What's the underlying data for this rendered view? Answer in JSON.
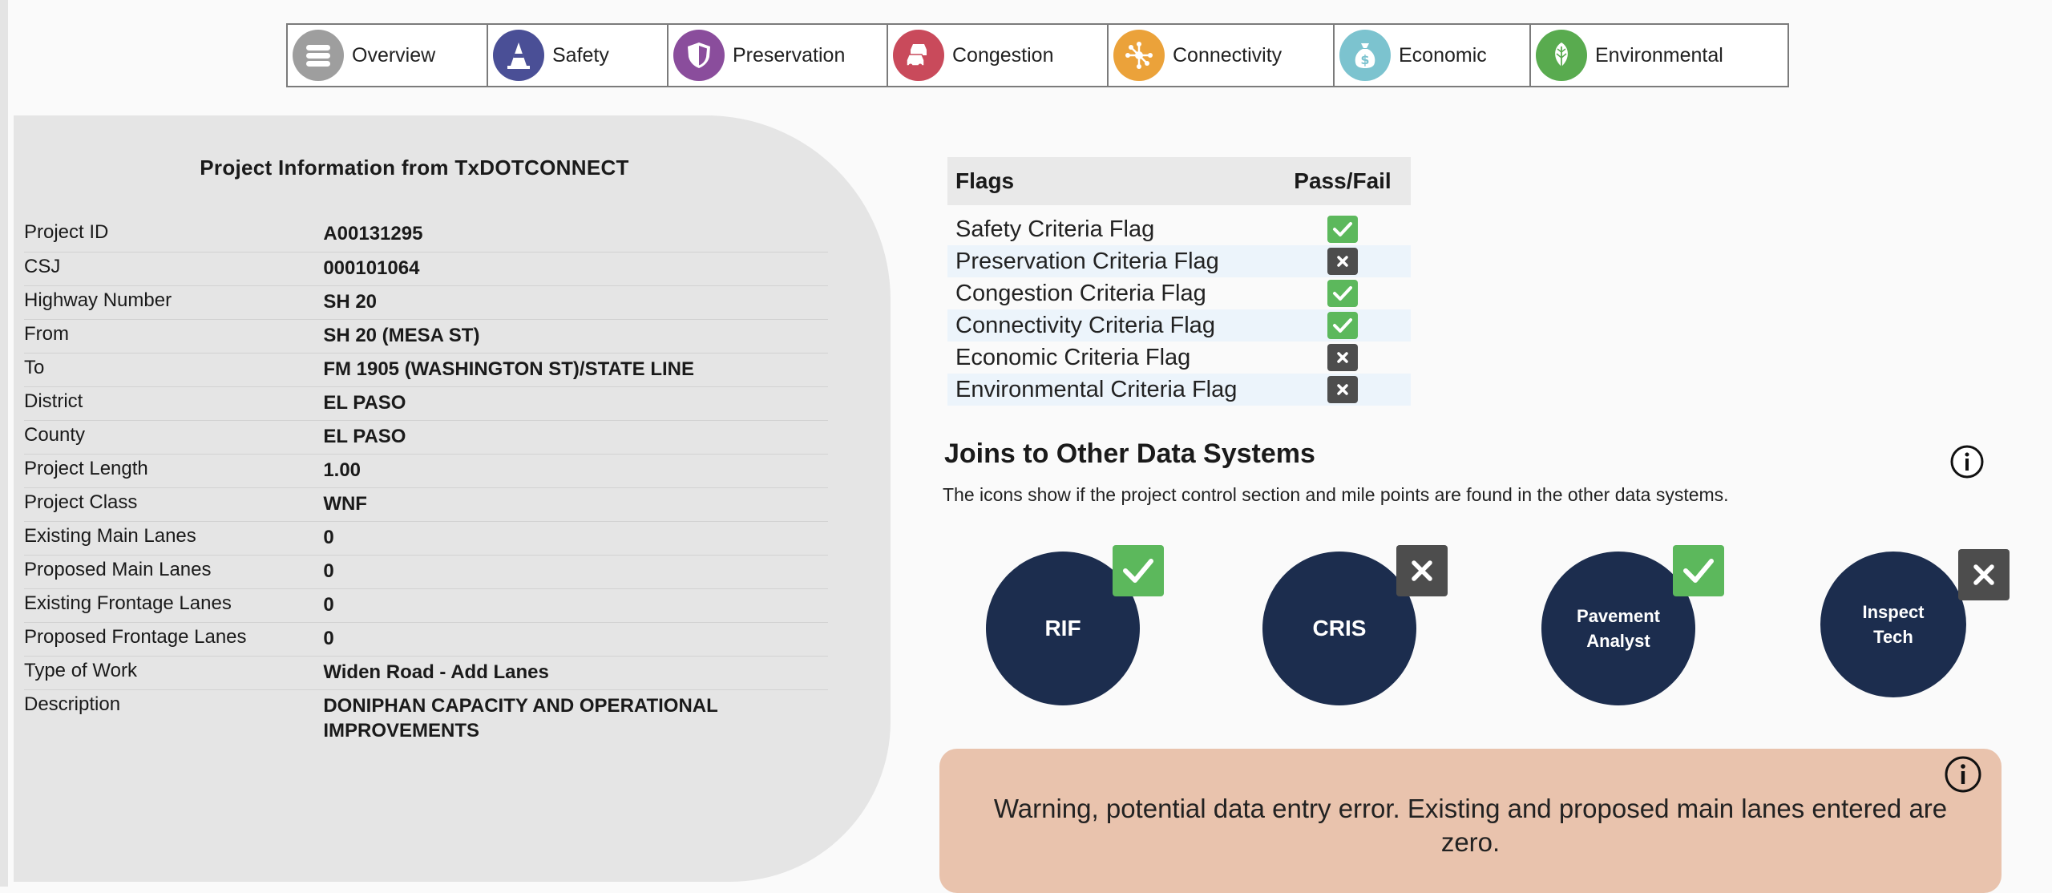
{
  "nav": {
    "tabs": [
      {
        "label": "Overview",
        "icon": "overview-icon",
        "color": "#9e9e9e"
      },
      {
        "label": "Safety",
        "icon": "safety-cone-icon",
        "color": "#4a4f96"
      },
      {
        "label": "Preservation",
        "icon": "shield-icon",
        "color": "#8a4d9c"
      },
      {
        "label": "Congestion",
        "icon": "cars-icon",
        "color": "#c94a5b"
      },
      {
        "label": "Connectivity",
        "icon": "network-icon",
        "color": "#eba23a"
      },
      {
        "label": "Economic",
        "icon": "money-bag-icon",
        "color": "#7cc3cf"
      },
      {
        "label": "Environmental",
        "icon": "leaf-icon",
        "color": "#59ab4f"
      }
    ]
  },
  "project": {
    "title": "Project Information from TxDOTCONNECT",
    "rows": [
      {
        "label": "Project ID",
        "value": "A00131295"
      },
      {
        "label": "CSJ",
        "value": "000101064"
      },
      {
        "label": "Highway Number",
        "value": "SH 20"
      },
      {
        "label": "From",
        "value": "SH 20 (MESA ST)"
      },
      {
        "label": "To",
        "value": "FM 1905 (WASHINGTON ST)/STATE LINE"
      },
      {
        "label": "District",
        "value": "EL PASO"
      },
      {
        "label": "County",
        "value": "EL PASO"
      },
      {
        "label": "Project Length",
        "value": "1.00"
      },
      {
        "label": "Project Class",
        "value": "WNF"
      },
      {
        "label": "Existing Main Lanes",
        "value": "0"
      },
      {
        "label": "Proposed Main Lanes",
        "value": "0"
      },
      {
        "label": "Existing Frontage Lanes",
        "value": "0"
      },
      {
        "label": "Proposed Frontage Lanes",
        "value": "0"
      },
      {
        "label": "Type of Work",
        "value": "Widen Road - Add Lanes"
      },
      {
        "label": "Description",
        "value": "DONIPHAN CAPACITY AND OPERATIONAL IMPROVEMENTS"
      }
    ]
  },
  "flags": {
    "header_flags": "Flags",
    "header_pass_fail": "Pass/Fail",
    "rows": [
      {
        "label": "Safety Criteria Flag",
        "status": "pass"
      },
      {
        "label": "Preservation Criteria Flag",
        "status": "fail"
      },
      {
        "label": "Congestion Criteria Flag",
        "status": "pass"
      },
      {
        "label": "Connectivity Criteria Flag",
        "status": "pass"
      },
      {
        "label": "Economic Criteria Flag",
        "status": "fail"
      },
      {
        "label": "Environmental Criteria Flag",
        "status": "fail"
      }
    ]
  },
  "joins": {
    "title": "Joins to Other Data Systems",
    "description": "The icons show if the project control section and mile points are found in the other data systems.",
    "systems": [
      {
        "label": "RIF",
        "status": "pass"
      },
      {
        "label": "CRIS",
        "status": "fail"
      },
      {
        "label": "Pavement Analyst",
        "status": "pass"
      },
      {
        "label": "Inspect Tech",
        "status": "fail"
      }
    ]
  },
  "warning": {
    "text": "Warning, potential data entry error. Existing and proposed main lanes entered are zero."
  },
  "colors": {
    "pass": "#5cb85c",
    "fail": "#4d4d4d",
    "system_circle": "#1c2d4e",
    "warning_bg": "#e9c3ad",
    "panel_bg": "#e5e5e5"
  }
}
